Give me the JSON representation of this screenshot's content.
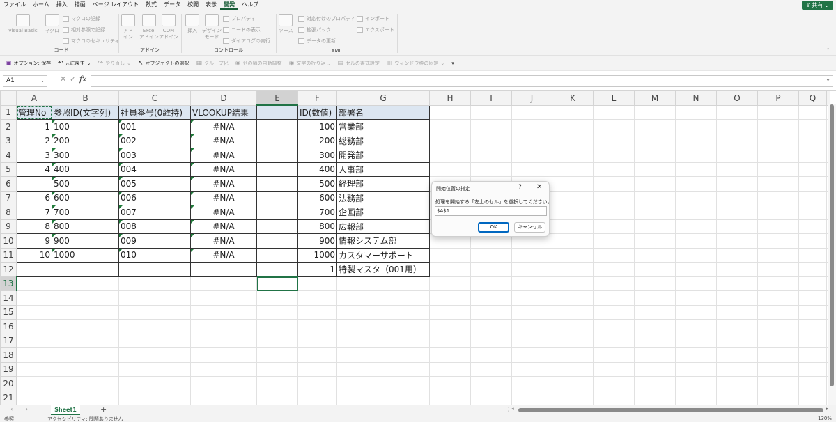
{
  "menu": [
    "ファイル",
    "ホーム",
    "挿入",
    "描画",
    "ページ レイアウト",
    "数式",
    "データ",
    "校閲",
    "表示",
    "開発",
    "ヘルプ"
  ],
  "menu_active": "開発",
  "share_label": "共有",
  "ribbon": {
    "code": {
      "label": "コード",
      "visual_basic": "Visual Basic",
      "macro": "マクロ",
      "record_macro": "マクロの記録",
      "relative_ref": "相対参照で記録",
      "macro_security": "マクロのセキュリティ"
    },
    "addin": {
      "label": "アドイン",
      "addin": "アド\nイン",
      "excel_addin": "Excel\nアドイン",
      "com_addin": "COM\nアドイン"
    },
    "controls": {
      "label": "コントロール",
      "insert": "挿入",
      "design_mode": "デザイン\nモード",
      "properties": "プロパティ",
      "view_code": "コードの表示",
      "run_dialog": "ダイアログの実行"
    },
    "xml": {
      "label": "XML",
      "source": "ソース",
      "map_props": "対応付けのプロパティ",
      "expansion": "拡張パック",
      "refresh": "データの更新",
      "import": "インポート",
      "export": "エクスポート"
    }
  },
  "qat": {
    "options_save": "オプション: 保存",
    "undo": "元に戻す",
    "redo": "やり直し",
    "select_objects": "オブジェクトの選択",
    "group": "グループ化",
    "autofit": "列の幅の自動調整",
    "wrap": "文字の折り返し",
    "cell_format": "セルの書式設定",
    "freeze": "ウィンドウ枠の固定"
  },
  "formula_bar": {
    "name_box": "A1",
    "fx": "fx",
    "value": ""
  },
  "grid": {
    "columns": [
      "A",
      "B",
      "C",
      "D",
      "E",
      "F",
      "G",
      "H",
      "I",
      "J",
      "K",
      "L",
      "M",
      "N",
      "O",
      "P",
      "Q"
    ],
    "rows": [
      {
        "n": "1",
        "A": "管理No",
        "B": "参照ID(文字列)",
        "C": "社員番号(0維持)",
        "D": "VLOOKUP結果",
        "E": "",
        "F": "ID(数値)",
        "G": "部署名"
      },
      {
        "n": "2",
        "A": "1",
        "B": "100",
        "C": "001",
        "D": "#N/A",
        "E": "",
        "F": "100",
        "G": "営業部"
      },
      {
        "n": "3",
        "A": "2",
        "B": "200",
        "C": "002",
        "D": "#N/A",
        "E": "",
        "F": "200",
        "G": "総務部"
      },
      {
        "n": "4",
        "A": "3",
        "B": "300",
        "C": "003",
        "D": "#N/A",
        "E": "",
        "F": "300",
        "G": "開発部"
      },
      {
        "n": "5",
        "A": "4",
        "B": "400",
        "C": "004",
        "D": "#N/A",
        "E": "",
        "F": "400",
        "G": "人事部"
      },
      {
        "n": "6",
        "A": "",
        "B": "500",
        "C": "005",
        "D": "#N/A",
        "E": "",
        "F": "500",
        "G": "経理部"
      },
      {
        "n": "7",
        "A": "6",
        "B": "600",
        "C": "006",
        "D": "#N/A",
        "E": "",
        "F": "600",
        "G": "法務部"
      },
      {
        "n": "8",
        "A": "7",
        "B": "700",
        "C": "007",
        "D": "#N/A",
        "E": "",
        "F": "700",
        "G": "企画部"
      },
      {
        "n": "9",
        "A": "8",
        "B": "800",
        "C": "008",
        "D": "#N/A",
        "E": "",
        "F": "800",
        "G": "広報部"
      },
      {
        "n": "10",
        "A": "9",
        "B": "900",
        "C": "009",
        "D": "#N/A",
        "E": "",
        "F": "900",
        "G": "情報システム部"
      },
      {
        "n": "11",
        "A": "10",
        "B": "1000",
        "C": "010",
        "D": "#N/A",
        "E": "",
        "F": "1000",
        "G": "カスタマーサポート"
      },
      {
        "n": "12",
        "A": "",
        "B": "",
        "C": "",
        "D": "",
        "E": "",
        "F": "1",
        "G": "特製マスタ（001用）"
      },
      {
        "n": "13"
      },
      {
        "n": "14"
      },
      {
        "n": "15"
      },
      {
        "n": "16"
      },
      {
        "n": "17"
      },
      {
        "n": "18"
      },
      {
        "n": "19"
      },
      {
        "n": "20"
      },
      {
        "n": "21"
      }
    ]
  },
  "dialog": {
    "title": "開始位置の指定",
    "help": "?",
    "close": "✕",
    "message": "処理を開始する「左上のセル」を選択してください。",
    "input_value": "$A$1",
    "ok": "OK",
    "cancel": "キャンセル"
  },
  "sheet_tab": "Sheet1",
  "add_sheet": "+",
  "status": {
    "mode": "参照",
    "accessibility": "アクセシビリティ: 問題ありません",
    "zoom": "130%"
  },
  "colors": {
    "accent": "#217346",
    "header_fill": "#dce6f1",
    "dialog_ok_border": "#0067c0"
  }
}
